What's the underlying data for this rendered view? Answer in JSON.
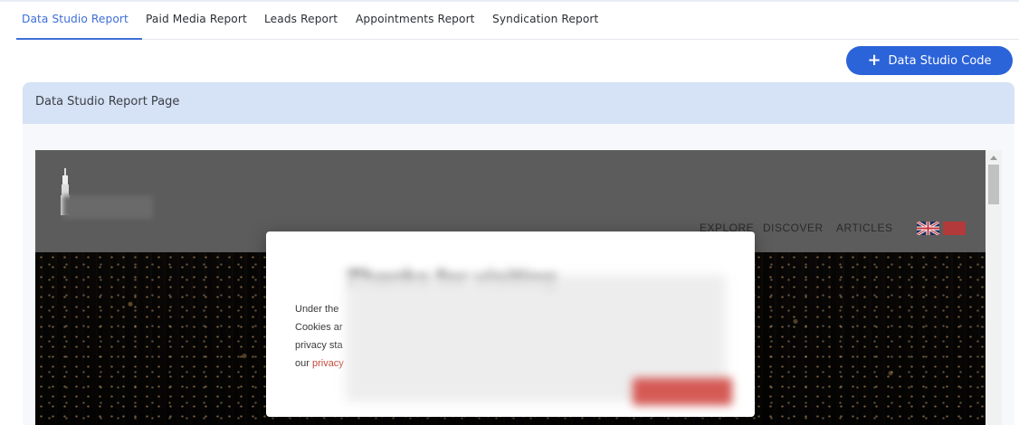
{
  "tabs": [
    {
      "label": "Data Studio Report",
      "active": true
    },
    {
      "label": "Paid Media Report",
      "active": false
    },
    {
      "label": "Leads Report",
      "active": false
    },
    {
      "label": "Appointments Report",
      "active": false
    },
    {
      "label": "Syndication Report",
      "active": false
    }
  ],
  "actions": {
    "add_code_label": "Data Studio Code",
    "add_code_icon": "plus-icon"
  },
  "card": {
    "title": "Data Studio Report Page"
  },
  "embed": {
    "nav": [
      "EXPLORE",
      "DISCOVER",
      "ARTICLES"
    ],
    "modal": {
      "line1": "Under the",
      "line2": "Cookies ar",
      "line3": "privacy sta",
      "line4_prefix": "our ",
      "link": "privacy"
    }
  },
  "colors": {
    "accent": "#2b63d9",
    "tab_active": "#3d6fd6",
    "card_header": "#d6e2f5"
  }
}
